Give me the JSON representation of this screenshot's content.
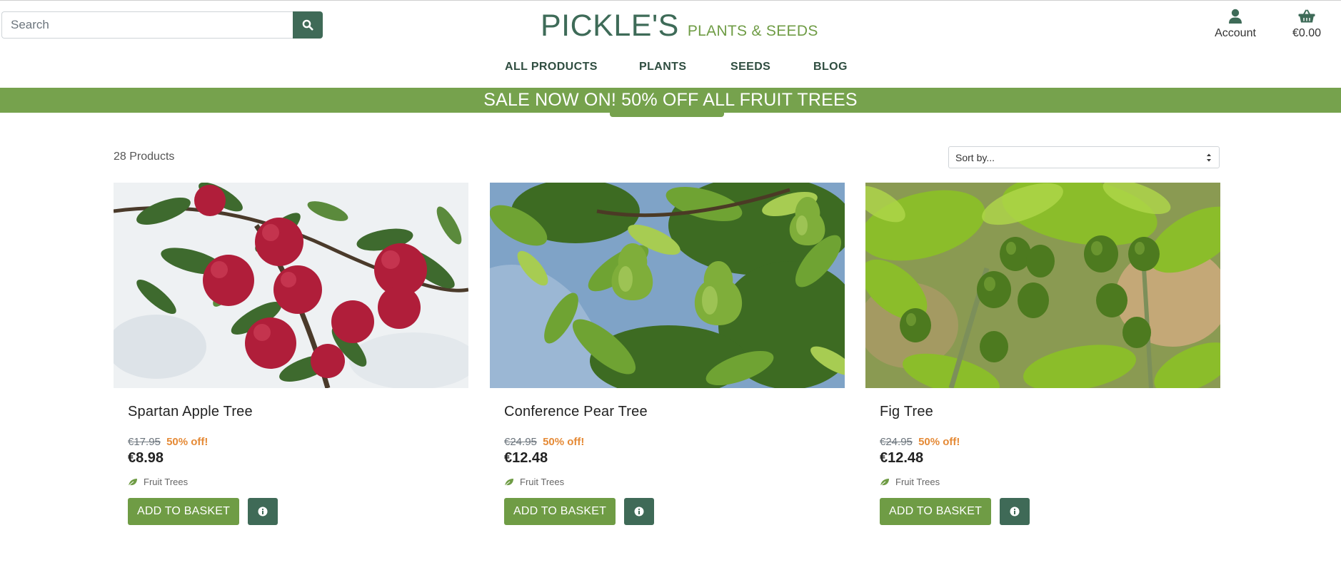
{
  "header": {
    "search_placeholder": "Search",
    "brand_main": "PICKLE'S",
    "brand_sub": "PLANTS & SEEDS",
    "account_label": "Account",
    "basket_total": "€0.00"
  },
  "nav": {
    "items": [
      {
        "label": "ALL PRODUCTS"
      },
      {
        "label": "PLANTS"
      },
      {
        "label": "SEEDS"
      },
      {
        "label": "BLOG"
      }
    ]
  },
  "banner": {
    "text": "SALE NOW ON! 50% OFF ALL FRUIT TREES"
  },
  "toolbar": {
    "product_count": "28 Products",
    "sort_selected": "Sort by..."
  },
  "products": [
    {
      "name": "Spartan Apple Tree",
      "old_price": "€17.95",
      "discount": "50% off!",
      "price": "€8.98",
      "category": "Fruit Trees",
      "add_label": "ADD TO BASKET"
    },
    {
      "name": "Conference Pear Tree",
      "old_price": "€24.95",
      "discount": "50% off!",
      "price": "€12.48",
      "category": "Fruit Trees",
      "add_label": "ADD TO BASKET"
    },
    {
      "name": "Fig Tree",
      "old_price": "€24.95",
      "discount": "50% off!",
      "price": "€12.48",
      "category": "Fruit Trees",
      "add_label": "ADD TO BASKET"
    }
  ],
  "colors": {
    "brand_dark": "#3e6b58",
    "brand_light": "#6f9c45",
    "banner": "#76a24d",
    "discount": "#e58a36"
  },
  "icons": [
    "search-icon",
    "user-icon",
    "basket-icon",
    "leaf-icon",
    "info-icon"
  ]
}
